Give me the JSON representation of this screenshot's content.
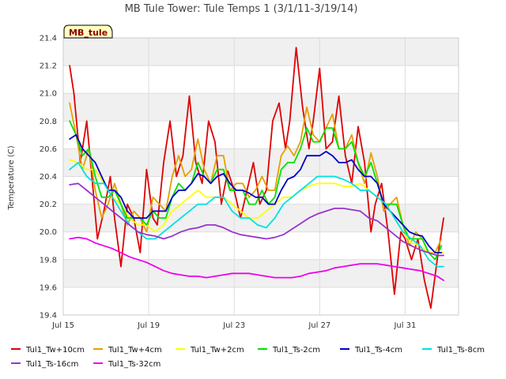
{
  "chart_data": {
    "type": "line",
    "title": "MB Tule Tower: Tule Temps 1 (3/1/11-3/19/14)",
    "ylabel": "Temperature (C)",
    "xlabel": "",
    "ylim": [
      19.4,
      21.4
    ],
    "yticks": [
      "19.4",
      "19.6",
      "19.8",
      "20.0",
      "20.2",
      "20.4",
      "20.6",
      "20.8",
      "21.0",
      "21.2",
      "21.4"
    ],
    "xlim": [
      0,
      18.5
    ],
    "xticks": [
      {
        "label": "Jul 15",
        "value": 0
      },
      {
        "label": "Jul 19",
        "value": 4
      },
      {
        "label": "Jul 23",
        "value": 8
      },
      {
        "label": "Jul 27",
        "value": 12
      },
      {
        "label": "Jul 31",
        "value": 16
      }
    ],
    "grid": true,
    "banded_background": true,
    "station_tag": "MB_tule",
    "legend_position": "bottom",
    "series": [
      {
        "name": "Tul1_Tw+10cm",
        "color": "#e00000",
        "x": [
          0.3,
          0.5,
          0.8,
          1.1,
          1.4,
          1.6,
          1.9,
          2.2,
          2.4,
          2.7,
          3.0,
          3.3,
          3.6,
          3.9,
          4.2,
          4.4,
          4.7,
          5.0,
          5.3,
          5.6,
          5.9,
          6.2,
          6.5,
          6.8,
          7.1,
          7.4,
          7.7,
          8.0,
          8.3,
          8.6,
          8.9,
          9.2,
          9.5,
          9.8,
          10.1,
          10.4,
          10.6,
          10.9,
          11.2,
          11.5,
          11.7,
          12.0,
          12.3,
          12.6,
          12.9,
          13.2,
          13.5,
          13.8,
          14.1,
          14.4,
          14.6,
          14.9,
          15.2,
          15.5,
          15.8,
          16.0,
          16.3,
          16.6,
          16.9,
          17.2,
          17.5,
          17.8
        ],
        "y": [
          21.2,
          21.0,
          20.5,
          20.8,
          20.3,
          19.95,
          20.15,
          20.4,
          20.1,
          19.75,
          20.2,
          20.1,
          19.85,
          20.45,
          20.1,
          20.05,
          20.5,
          20.8,
          20.4,
          20.55,
          20.98,
          20.5,
          20.35,
          20.8,
          20.65,
          20.2,
          20.44,
          20.3,
          20.1,
          20.3,
          20.5,
          20.2,
          20.3,
          20.8,
          20.93,
          20.6,
          20.8,
          21.33,
          20.9,
          20.6,
          20.8,
          21.18,
          20.6,
          20.65,
          20.98,
          20.55,
          20.35,
          20.76,
          20.5,
          20.0,
          20.2,
          20.35,
          20.0,
          19.55,
          20.0,
          19.95,
          19.8,
          19.95,
          19.65,
          19.45,
          19.8,
          20.1
        ]
      },
      {
        "name": "Tul1_Tw+4cm",
        "color": "#e5a000",
        "x": [
          0.3,
          0.6,
          0.9,
          1.2,
          1.5,
          1.8,
          2.1,
          2.4,
          2.7,
          3.0,
          3.3,
          3.6,
          3.9,
          4.2,
          4.5,
          4.8,
          5.1,
          5.4,
          5.7,
          6.0,
          6.3,
          6.6,
          6.9,
          7.2,
          7.5,
          7.8,
          8.1,
          8.4,
          8.7,
          9.0,
          9.3,
          9.6,
          9.9,
          10.2,
          10.5,
          10.8,
          11.1,
          11.4,
          11.7,
          12.0,
          12.3,
          12.6,
          12.9,
          13.2,
          13.5,
          13.8,
          14.1,
          14.4,
          14.7,
          15.0,
          15.3,
          15.6,
          15.9,
          16.2,
          16.5,
          16.8,
          17.1,
          17.4,
          17.7
        ],
        "y": [
          20.93,
          20.7,
          20.45,
          20.6,
          20.3,
          20.1,
          20.2,
          20.35,
          20.2,
          20.05,
          20.15,
          20.1,
          20.0,
          20.25,
          20.2,
          20.15,
          20.4,
          20.55,
          20.4,
          20.45,
          20.67,
          20.45,
          20.35,
          20.55,
          20.55,
          20.3,
          20.35,
          20.35,
          20.25,
          20.3,
          20.4,
          20.3,
          20.3,
          20.55,
          20.62,
          20.55,
          20.65,
          20.9,
          20.7,
          20.65,
          20.75,
          20.85,
          20.6,
          20.6,
          20.7,
          20.5,
          20.35,
          20.57,
          20.4,
          20.15,
          20.2,
          20.25,
          20.05,
          19.9,
          20.0,
          19.95,
          19.85,
          19.85,
          19.95
        ]
      },
      {
        "name": "Tul1_Tw+2cm",
        "color": "#ffff00",
        "x": [
          0.3,
          0.7,
          1.1,
          1.5,
          1.9,
          2.3,
          2.7,
          3.1,
          3.5,
          3.9,
          4.3,
          4.7,
          5.1,
          5.5,
          5.9,
          6.3,
          6.7,
          7.1,
          7.5,
          7.9,
          8.3,
          8.7,
          9.1,
          9.5,
          9.9,
          10.3,
          10.7,
          11.1,
          11.5,
          11.9,
          12.3,
          12.7,
          13.1,
          13.5,
          13.9,
          14.3,
          14.7,
          15.1,
          15.5,
          15.9,
          16.3,
          16.7,
          17.1,
          17.5,
          17.8
        ],
        "y": [
          20.52,
          20.5,
          20.45,
          20.45,
          20.35,
          20.25,
          20.2,
          20.1,
          20.05,
          20.05,
          20.0,
          20.05,
          20.15,
          20.2,
          20.25,
          20.3,
          20.25,
          20.25,
          20.25,
          20.2,
          20.15,
          20.1,
          20.1,
          20.15,
          20.2,
          20.25,
          20.25,
          20.3,
          20.33,
          20.35,
          20.35,
          20.35,
          20.33,
          20.33,
          20.35,
          20.3,
          20.25,
          20.2,
          20.1,
          20.0,
          19.92,
          19.9,
          19.85,
          19.85,
          19.85
        ]
      },
      {
        "name": "Tul1_Ts-2cm",
        "color": "#00e000",
        "x": [
          0.3,
          0.6,
          0.9,
          1.2,
          1.5,
          1.8,
          2.1,
          2.4,
          2.7,
          3.0,
          3.3,
          3.6,
          3.9,
          4.2,
          4.5,
          4.8,
          5.1,
          5.4,
          5.7,
          6.0,
          6.3,
          6.6,
          6.9,
          7.2,
          7.5,
          7.8,
          8.1,
          8.4,
          8.7,
          9.0,
          9.3,
          9.6,
          9.9,
          10.2,
          10.5,
          10.8,
          11.1,
          11.4,
          11.7,
          12.0,
          12.3,
          12.6,
          12.9,
          13.2,
          13.5,
          13.8,
          14.1,
          14.4,
          14.7,
          15.0,
          15.3,
          15.6,
          15.9,
          16.2,
          16.5,
          16.8,
          17.1,
          17.4,
          17.7
        ],
        "y": [
          20.8,
          20.7,
          20.55,
          20.6,
          20.4,
          20.25,
          20.25,
          20.3,
          20.2,
          20.1,
          20.1,
          20.1,
          20.05,
          20.15,
          20.1,
          20.1,
          20.25,
          20.35,
          20.3,
          20.35,
          20.5,
          20.4,
          20.35,
          20.45,
          20.45,
          20.3,
          20.3,
          20.3,
          20.2,
          20.2,
          20.3,
          20.2,
          20.25,
          20.45,
          20.5,
          20.5,
          20.6,
          20.75,
          20.65,
          20.65,
          20.75,
          20.75,
          20.6,
          20.6,
          20.65,
          20.5,
          20.4,
          20.5,
          20.35,
          20.2,
          20.2,
          20.2,
          20.05,
          19.95,
          19.95,
          19.95,
          19.85,
          19.8,
          19.9
        ]
      },
      {
        "name": "Tul1_Ts-4cm",
        "color": "#0000c8",
        "x": [
          0.3,
          0.6,
          0.9,
          1.2,
          1.5,
          1.8,
          2.1,
          2.4,
          2.7,
          3.0,
          3.3,
          3.6,
          3.9,
          4.2,
          4.5,
          4.8,
          5.1,
          5.4,
          5.7,
          6.0,
          6.3,
          6.6,
          6.9,
          7.2,
          7.5,
          7.8,
          8.1,
          8.4,
          8.7,
          9.0,
          9.3,
          9.6,
          9.9,
          10.2,
          10.5,
          10.8,
          11.1,
          11.4,
          11.7,
          12.0,
          12.3,
          12.6,
          12.9,
          13.2,
          13.5,
          13.8,
          14.1,
          14.4,
          14.7,
          15.0,
          15.3,
          15.6,
          15.9,
          16.2,
          16.5,
          16.8,
          17.1,
          17.4,
          17.7
        ],
        "y": [
          20.67,
          20.7,
          20.6,
          20.55,
          20.5,
          20.4,
          20.3,
          20.3,
          20.25,
          20.15,
          20.1,
          20.1,
          20.1,
          20.15,
          20.15,
          20.15,
          20.25,
          20.3,
          20.3,
          20.35,
          20.42,
          20.4,
          20.35,
          20.4,
          20.42,
          20.35,
          20.3,
          20.3,
          20.28,
          20.25,
          20.25,
          20.2,
          20.2,
          20.3,
          20.38,
          20.4,
          20.45,
          20.55,
          20.55,
          20.55,
          20.58,
          20.55,
          20.5,
          20.5,
          20.52,
          20.45,
          20.4,
          20.4,
          20.35,
          20.2,
          20.15,
          20.1,
          20.05,
          20.0,
          19.98,
          19.97,
          19.9,
          19.85,
          19.85
        ]
      },
      {
        "name": "Tul1_Ts-8cm",
        "color": "#00e0e0",
        "x": [
          0.3,
          0.7,
          1.1,
          1.5,
          1.9,
          2.3,
          2.7,
          3.1,
          3.5,
          3.9,
          4.3,
          4.7,
          5.1,
          5.5,
          5.9,
          6.3,
          6.7,
          7.1,
          7.5,
          7.9,
          8.3,
          8.7,
          9.1,
          9.5,
          9.9,
          10.3,
          10.7,
          11.1,
          11.5,
          11.9,
          12.3,
          12.7,
          13.1,
          13.5,
          13.9,
          14.3,
          14.7,
          15.1,
          15.5,
          15.9,
          16.3,
          16.7,
          17.1,
          17.5,
          17.8
        ],
        "y": [
          20.45,
          20.5,
          20.4,
          20.35,
          20.35,
          20.25,
          20.15,
          20.05,
          20.0,
          19.95,
          19.95,
          20.0,
          20.05,
          20.1,
          20.15,
          20.2,
          20.2,
          20.25,
          20.25,
          20.15,
          20.1,
          20.1,
          20.05,
          20.03,
          20.1,
          20.2,
          20.25,
          20.3,
          20.35,
          20.4,
          20.4,
          20.4,
          20.38,
          20.35,
          20.3,
          20.3,
          20.25,
          20.2,
          20.1,
          20.0,
          19.95,
          19.9,
          19.8,
          19.75,
          19.75
        ]
      },
      {
        "name": "Tul1_Ts-16cm",
        "color": "#9933cc",
        "x": [
          0.3,
          0.7,
          1.1,
          1.5,
          1.9,
          2.3,
          2.7,
          3.1,
          3.5,
          3.9,
          4.3,
          4.7,
          5.1,
          5.5,
          5.9,
          6.3,
          6.7,
          7.1,
          7.5,
          7.9,
          8.3,
          8.7,
          9.1,
          9.5,
          9.9,
          10.3,
          10.7,
          11.1,
          11.5,
          11.9,
          12.3,
          12.7,
          13.1,
          13.5,
          13.9,
          14.3,
          14.7,
          15.1,
          15.5,
          15.9,
          16.3,
          16.7,
          17.1,
          17.5,
          17.8
        ],
        "y": [
          20.34,
          20.35,
          20.3,
          20.25,
          20.2,
          20.15,
          20.1,
          20.05,
          20.0,
          19.98,
          19.97,
          19.95,
          19.97,
          20.0,
          20.02,
          20.03,
          20.05,
          20.05,
          20.03,
          20.0,
          19.98,
          19.97,
          19.96,
          19.95,
          19.96,
          19.98,
          20.02,
          20.06,
          20.1,
          20.13,
          20.15,
          20.17,
          20.17,
          20.16,
          20.15,
          20.1,
          20.08,
          20.03,
          19.98,
          19.93,
          19.9,
          19.87,
          19.85,
          19.83,
          19.83
        ]
      },
      {
        "name": "Tul1_Ts-32cm",
        "color": "#ee00ee",
        "x": [
          0.3,
          0.7,
          1.1,
          1.5,
          1.9,
          2.3,
          2.7,
          3.1,
          3.5,
          3.9,
          4.3,
          4.7,
          5.1,
          5.5,
          5.9,
          6.3,
          6.7,
          7.1,
          7.5,
          7.9,
          8.3,
          8.7,
          9.1,
          9.5,
          9.9,
          10.3,
          10.7,
          11.1,
          11.5,
          11.9,
          12.3,
          12.7,
          13.1,
          13.5,
          13.9,
          14.3,
          14.7,
          15.1,
          15.5,
          15.9,
          16.3,
          16.7,
          17.1,
          17.5,
          17.8
        ],
        "y": [
          19.95,
          19.96,
          19.95,
          19.92,
          19.9,
          19.88,
          19.85,
          19.82,
          19.8,
          19.78,
          19.75,
          19.72,
          19.7,
          19.69,
          19.68,
          19.68,
          19.67,
          19.68,
          19.69,
          19.7,
          19.7,
          19.7,
          19.69,
          19.68,
          19.67,
          19.67,
          19.67,
          19.68,
          19.7,
          19.71,
          19.72,
          19.74,
          19.75,
          19.76,
          19.77,
          19.77,
          19.77,
          19.76,
          19.75,
          19.74,
          19.73,
          19.72,
          19.7,
          19.68,
          19.65
        ]
      }
    ]
  }
}
